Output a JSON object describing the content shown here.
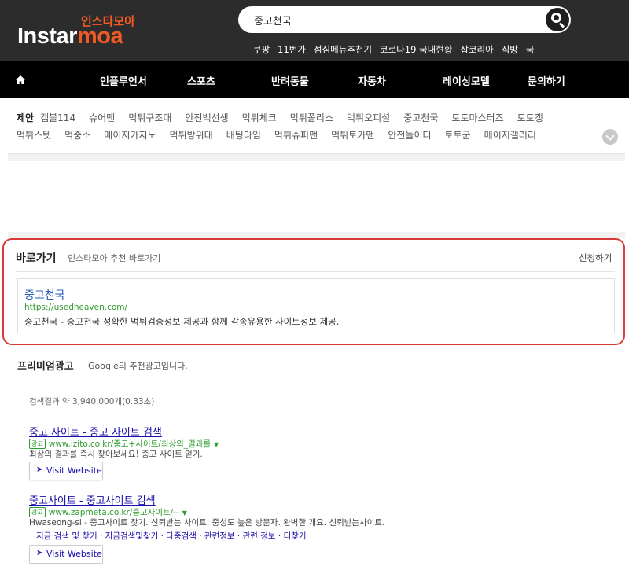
{
  "header": {
    "logo_ko": "인스타모아",
    "logo_en_main": "Instar",
    "logo_en_accent": "moa",
    "search_value": "중고천국",
    "quick_links": [
      "쿠팡",
      "11번가",
      "점심메뉴추천기",
      "코로나19 국내현황",
      "잡코리아",
      "직방",
      "국"
    ]
  },
  "nav": {
    "items": [
      "인플루언서",
      "스포츠",
      "반려동물",
      "자동차",
      "레이싱모델",
      "문의하기"
    ]
  },
  "suggest": {
    "label": "제안",
    "row1": [
      "겜블114",
      "슈어맨",
      "먹튀구조대",
      "안전백선생",
      "먹튀체크",
      "먹튀폴리스",
      "먹튀오피셜",
      "중고천국",
      "토토마스터즈",
      "토토갱"
    ],
    "row2": [
      "먹튀스텟",
      "먹중소",
      "메이저카지노",
      "먹튀방위대",
      "배팅타임",
      "먹튀슈퍼맨",
      "먹튀토카맨",
      "안전놀이터",
      "토토군",
      "메이저갤러리"
    ]
  },
  "shortcut": {
    "title": "바로가기",
    "subtitle": "인스타모아 추천 바로가기",
    "apply": "신청하기",
    "site": {
      "name": "중고천국",
      "url": "https://usedheaven.com/",
      "desc": "중고천국 - 중고천국 정확한 먹튀검증정보 제공과 함께 각종유용한 사이트정보 제공."
    }
  },
  "premium": {
    "title": "프리미엄광고",
    "subtitle": "Google의 추천광고입니다.",
    "results_count": "검색결과 약 3,940,000개(0.33초)",
    "ads": [
      {
        "title": "중고 사이트 - 중고 사이트 검색",
        "badge": "광고",
        "url": "www.izito.co.kr/중고+사이트/최상의_결과를",
        "desc": "최상의 결과를 즉시 찾아보세요! 중고 사이트 얻기.",
        "button": "Visit Website"
      },
      {
        "title": "중고사이트 - 중고사이트 검색",
        "badge": "광고",
        "url": "www.zapmeta.co.kr/중고사이트/--",
        "desc": "Hwaseong-si - 중고사이트 찾기. 신뢰받는 사이트. 중성도 높은 방문자. 완벽한 개요. 신뢰받는사이트.",
        "sitelinks": "지금 검색 및 찾기 · 지금검색및찾기 · 다중검색 · 관련정보 · 관련 정보 · 더찾기",
        "button": "Visit Website"
      }
    ]
  },
  "colors": {
    "brand_orange": "#f15a24",
    "header_bg": "#2c2c2c",
    "nav_bg": "#000000",
    "highlight_border": "#d93a3a",
    "link_blue": "#1a0dab",
    "url_green": "#2e9b2e"
  }
}
